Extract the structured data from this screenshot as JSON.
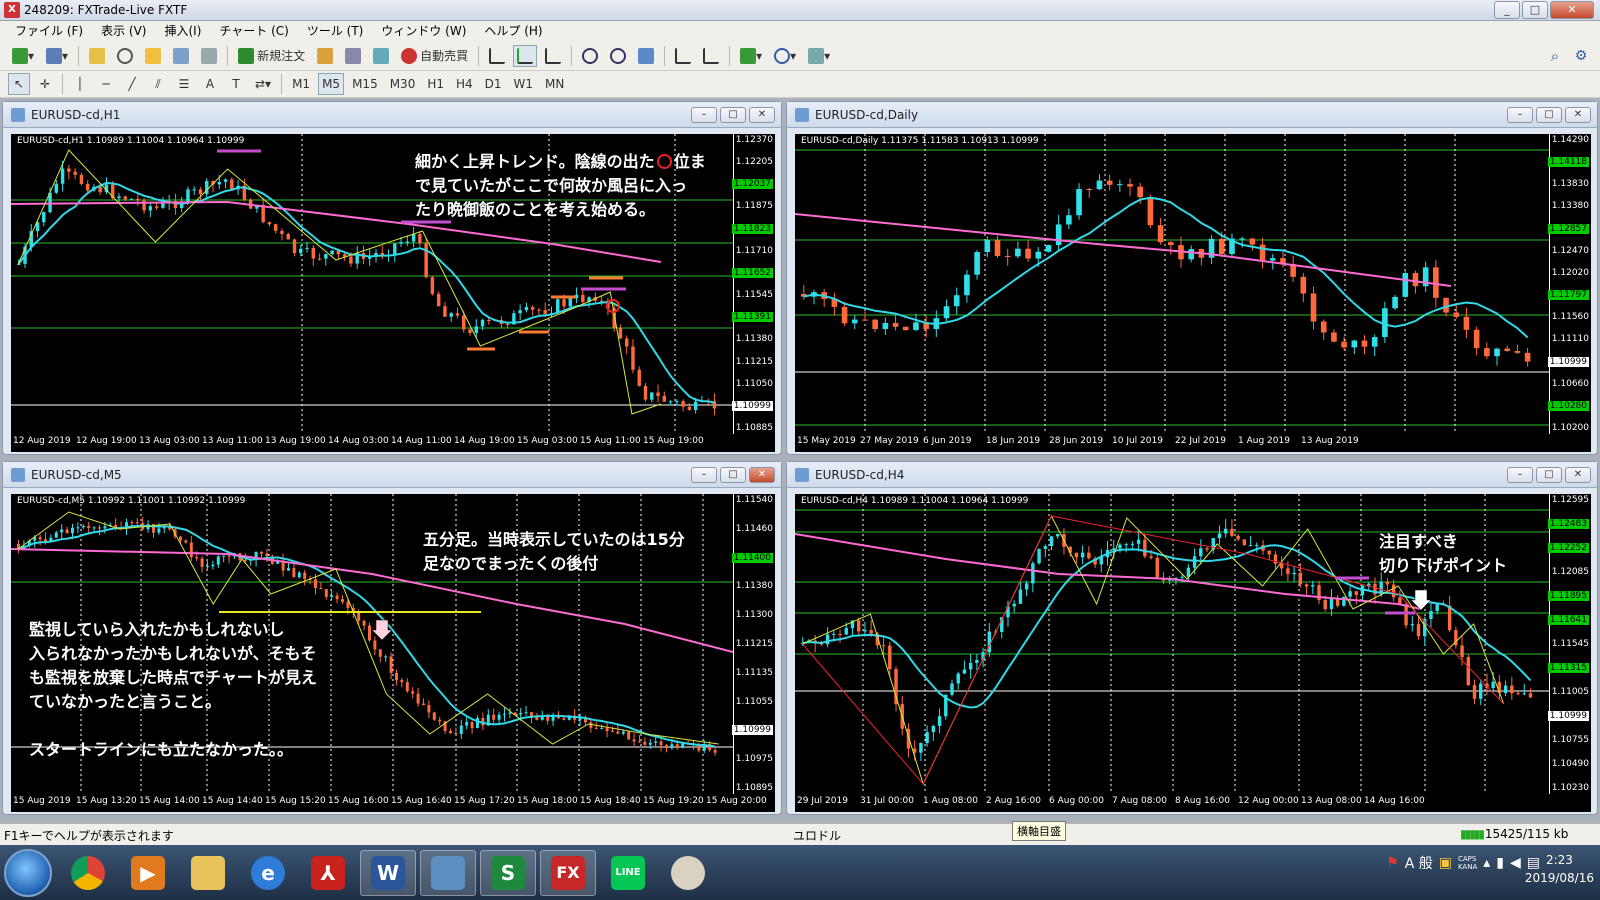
{
  "window": {
    "title": "248209: FXTrade-Live FXTF",
    "app_icon": "X"
  },
  "menu": [
    "ファイル (F)",
    "表示 (V)",
    "挿入(I)",
    "チャート (C)",
    "ツール (T)",
    "ウィンドウ (W)",
    "ヘルプ (H)"
  ],
  "toolbar": {
    "new_order": "新規注文",
    "auto_trade": "自動売買",
    "timeframes": [
      "M1",
      "M5",
      "M15",
      "M30",
      "H1",
      "H4",
      "D1",
      "W1",
      "MN"
    ],
    "active_timeframe": "M5",
    "text_tool": "A"
  },
  "charts": {
    "h1": {
      "title": "EURUSD-cd,H1",
      "info": "EURUSD-cd,H1  1.10989 1.11004 1.10964 1.10999",
      "yticks": [
        "1.12370",
        "1.12205",
        "1.12037",
        "1.11875",
        "1.11823",
        "1.11710",
        "1.11652",
        "1.11545",
        "1.11391",
        "1.11380",
        "1.11215",
        "1.11050",
        "1.10999",
        "1.10885"
      ],
      "xticks": [
        "12 Aug 2019",
        "12 Aug 19:00",
        "13 Aug 03:00",
        "13 Aug 11:00",
        "13 Aug 19:00",
        "14 Aug 03:00",
        "14 Aug 11:00",
        "14 Aug 19:00",
        "15 Aug 03:00",
        "15 Aug 11:00",
        "15 Aug 19:00"
      ],
      "note": [
        "細かく上昇トレンド。陰線の出た",
        "位ま",
        "で見ていたがここで何故か風呂に入っ",
        "たり晩御飯のことを考え始める。"
      ]
    },
    "daily": {
      "title": "EURUSD-cd,Daily",
      "info": "EURUSD-cd,Daily  1.11375 1.11583 1.10913 1.10999",
      "yticks": [
        "1.14290",
        "1.14118",
        "1.13830",
        "1.13380",
        "1.12857",
        "1.12470",
        "1.12020",
        "1.11797",
        "1.11560",
        "1.11110",
        "1.10999",
        "1.10660",
        "1.10280",
        "1.10200"
      ],
      "xticks": [
        "15 May 2019",
        "27 May 2019",
        "6 Jun 2019",
        "18 Jun 2019",
        "28 Jun 2019",
        "10 Jul 2019",
        "22 Jul 2019",
        "1 Aug 2019",
        "13 Aug 2019"
      ]
    },
    "m5": {
      "title": "EURUSD-cd,M5",
      "info": "EURUSD-cd,M5  1.10992 1.11001 1.10992 1.10999",
      "yticks": [
        "1.11540",
        "1.11460",
        "1.11400",
        "1.11380",
        "1.11300",
        "1.11215",
        "1.11135",
        "1.11055",
        "1.10999",
        "1.10975",
        "1.10895"
      ],
      "xticks": [
        "15 Aug 2019",
        "15 Aug 13:20",
        "15 Aug 14:00",
        "15 Aug 14:40",
        "15 Aug 15:20",
        "15 Aug 16:00",
        "15 Aug 16:40",
        "15 Aug 17:20",
        "15 Aug 18:00",
        "15 Aug 18:40",
        "15 Aug 19:20",
        "15 Aug 20:00"
      ],
      "note_top": [
        "五分足。当時表示していたのは15分",
        "足なのでまったくの後付"
      ],
      "note_left": [
        "監視していら入れたかもしれないし",
        "入られなかったかもしれないが、そもそ",
        "も監視を放棄した時点でチャートが見え",
        "ていなかったと言うこと。",
        "",
        "スタートラインにも立たなかった。。"
      ]
    },
    "h4": {
      "title": "EURUSD-cd,H4",
      "info": "EURUSD-cd,H4  1.10989 1.11004 1.10964 1.10999",
      "yticks": [
        "1.12595",
        "1.12483",
        "1.12252",
        "1.12085",
        "1.11895",
        "1.11641",
        "1.11545",
        "1.11315",
        "1.11005",
        "1.10999",
        "1.10755",
        "1.10490",
        "1.10230"
      ],
      "xticks": [
        "29 Jul 2019",
        "31 Jul 00:00",
        "1 Aug 08:00",
        "2 Aug 16:00",
        "6 Aug 00:00",
        "7 Aug 08:00",
        "8 Aug 16:00",
        "12 Aug 00:00",
        "13 Aug 08:00",
        "14 Aug 16:00"
      ],
      "note": [
        "注目すべき",
        "切り下げポイント"
      ]
    }
  },
  "status": {
    "help": "F1キーでヘルプが表示されます",
    "profile": "ユロドル",
    "tooltip": "横軸目盛",
    "traffic": "15425/115 kb"
  },
  "taskbar": {
    "apps": [
      "chrome-icon",
      "media-icon",
      "folder-icon",
      "ie-icon",
      "pdf-icon",
      "word-icon",
      "viewer-icon",
      "excel-icon",
      "fx-icon",
      "line-icon",
      "paint-icon"
    ],
    "tray": {
      "ime": "A 般",
      "caps": "CAPS",
      "kana": "KANA"
    },
    "clock": {
      "time": "2:23",
      "date": "2019/08/16"
    }
  }
}
